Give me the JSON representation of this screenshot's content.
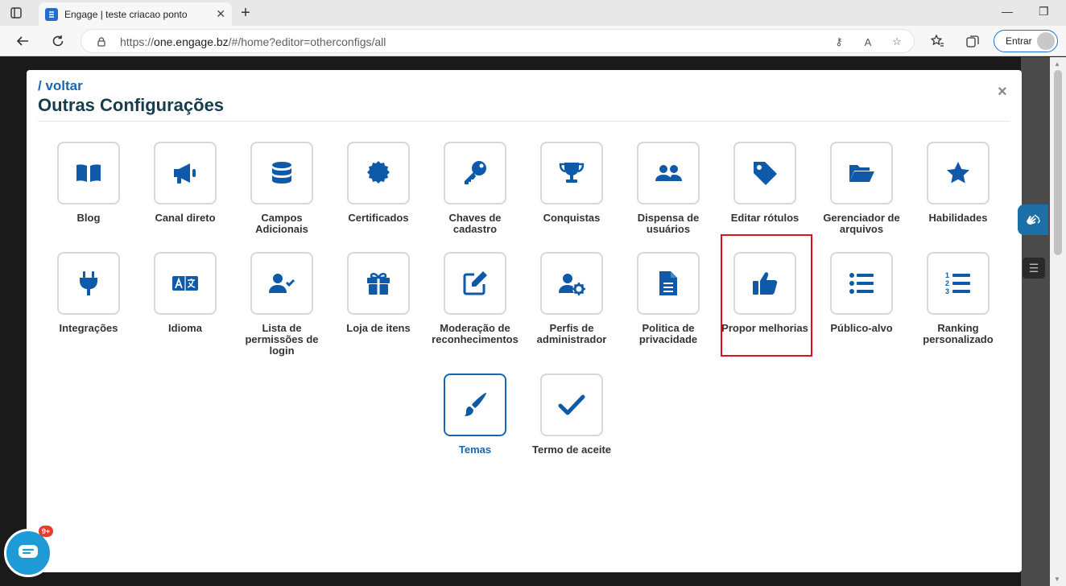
{
  "browser": {
    "tab_title": "Engage | teste criacao ponto",
    "url_scheme": "https://",
    "url_host": "one.engage.bz",
    "url_path": "/#/home?editor=otherconfigs/all",
    "signin_label": "Entrar"
  },
  "modal": {
    "back_label": "/ voltar",
    "title": "Outras Configurações",
    "close_label": "×"
  },
  "row1": [
    {
      "label": "Blog",
      "icon": "book-icon"
    },
    {
      "label": "Canal direto",
      "icon": "megaphone-icon"
    },
    {
      "label": "Campos Adicionais",
      "icon": "database-icon"
    },
    {
      "label": "Certificados",
      "icon": "certificate-icon"
    },
    {
      "label": "Chaves de cadastro",
      "icon": "key-icon"
    },
    {
      "label": "Conquistas",
      "icon": "trophy-icon"
    },
    {
      "label": "Dispensa de usuários",
      "icon": "users-icon"
    },
    {
      "label": "Editar rótulos",
      "icon": "tag-icon"
    },
    {
      "label": "Gerenciador de arquivos",
      "icon": "folder-open-icon"
    },
    {
      "label": "Habilidades",
      "icon": "star-icon"
    }
  ],
  "row2": [
    {
      "label": "Integrações",
      "icon": "plug-icon"
    },
    {
      "label": "Idioma",
      "icon": "language-icon"
    },
    {
      "label": "Lista de permissões de login",
      "icon": "user-check-icon"
    },
    {
      "label": "Loja de itens",
      "icon": "gift-icon"
    },
    {
      "label": "Moderação de reconhecimentos",
      "icon": "edit-icon"
    },
    {
      "label": "Perfis de administrador",
      "icon": "user-gear-icon"
    },
    {
      "label": "Politica de privacidade",
      "icon": "document-icon"
    },
    {
      "label": "Propor melhorias",
      "icon": "thumbs-up-icon"
    },
    {
      "label": "Público-alvo",
      "icon": "list-icon"
    },
    {
      "label": "Ranking personalizado",
      "icon": "ordered-list-icon"
    }
  ],
  "row3": [
    {
      "label": "Temas",
      "icon": "paintbrush-icon",
      "active": true
    },
    {
      "label": "Termo de aceite",
      "icon": "check-icon"
    }
  ],
  "chat": {
    "badge": "9+"
  },
  "colors": {
    "accent": "#1668b3",
    "icon": "#0f5aa8",
    "highlight": "#e0111c"
  }
}
